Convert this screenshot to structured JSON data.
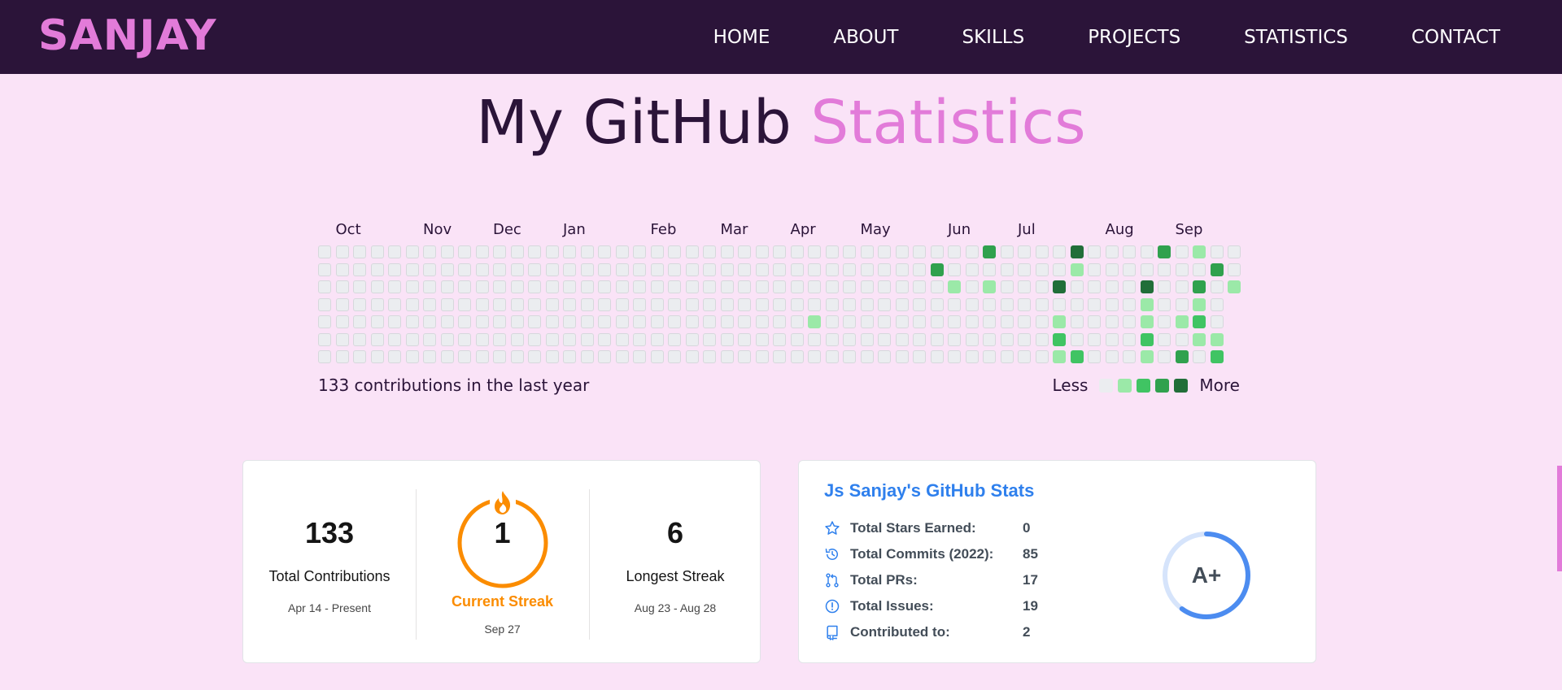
{
  "nav": {
    "logo": "SANJAY",
    "links": [
      "HOME",
      "ABOUT",
      "SKILLS",
      "PROJECTS",
      "STATISTICS",
      "CONTACT"
    ]
  },
  "heading": {
    "prefix": "My GitHub",
    "accent": "Statistics"
  },
  "calendar": {
    "months": [
      "Oct",
      "Nov",
      "Dec",
      "Jan",
      "Feb",
      "Mar",
      "Apr",
      "May",
      "Jun",
      "Jul",
      "Aug",
      "Sep"
    ],
    "month_week_index": [
      1,
      6,
      10,
      14,
      19,
      23,
      27,
      31,
      36,
      40,
      45,
      49
    ],
    "weeks": 53,
    "last_week_days": 3,
    "active_cells": [
      {
        "week": 38,
        "day": 0,
        "level": 3
      },
      {
        "week": 43,
        "day": 0,
        "level": 4
      },
      {
        "week": 48,
        "day": 0,
        "level": 3
      },
      {
        "week": 50,
        "day": 0,
        "level": 1
      },
      {
        "week": 35,
        "day": 1,
        "level": 3
      },
      {
        "week": 43,
        "day": 1,
        "level": 1
      },
      {
        "week": 51,
        "day": 1,
        "level": 3
      },
      {
        "week": 36,
        "day": 2,
        "level": 1
      },
      {
        "week": 38,
        "day": 2,
        "level": 1
      },
      {
        "week": 42,
        "day": 2,
        "level": 4
      },
      {
        "week": 47,
        "day": 2,
        "level": 4
      },
      {
        "week": 50,
        "day": 2,
        "level": 3
      },
      {
        "week": 52,
        "day": 2,
        "level": 1
      },
      {
        "week": 47,
        "day": 3,
        "level": 1
      },
      {
        "week": 50,
        "day": 3,
        "level": 1
      },
      {
        "week": 28,
        "day": 4,
        "level": 1
      },
      {
        "week": 42,
        "day": 4,
        "level": 1
      },
      {
        "week": 47,
        "day": 4,
        "level": 1
      },
      {
        "week": 49,
        "day": 4,
        "level": 1
      },
      {
        "week": 50,
        "day": 4,
        "level": 2
      },
      {
        "week": 42,
        "day": 5,
        "level": 2
      },
      {
        "week": 47,
        "day": 5,
        "level": 2
      },
      {
        "week": 50,
        "day": 5,
        "level": 1
      },
      {
        "week": 51,
        "day": 5,
        "level": 1
      },
      {
        "week": 42,
        "day": 6,
        "level": 1
      },
      {
        "week": 43,
        "day": 6,
        "level": 2
      },
      {
        "week": 47,
        "day": 6,
        "level": 1
      },
      {
        "week": 49,
        "day": 6,
        "level": 3
      },
      {
        "week": 51,
        "day": 6,
        "level": 2
      }
    ],
    "level_colors": [
      "#ebedf0",
      "#9be9a8",
      "#40c463",
      "#30a14e",
      "#216e39"
    ],
    "summary": "133 contributions in the last year",
    "legend_less": "Less",
    "legend_more": "More"
  },
  "streak": {
    "total": {
      "value": "133",
      "label": "Total Contributions",
      "range": "Apr 14 - Present"
    },
    "current": {
      "value": "1",
      "label": "Current Streak",
      "range": "Sep 27"
    },
    "longest": {
      "value": "6",
      "label": "Longest Streak",
      "range": "Aug 23 - Aug 28"
    },
    "accent_color": "#fb8c00"
  },
  "stats": {
    "title": "Js Sanjay's GitHub Stats",
    "rows": [
      {
        "icon": "star-icon",
        "label": "Total Stars Earned:",
        "value": "0"
      },
      {
        "icon": "history-icon",
        "label": "Total Commits (2022):",
        "value": "85"
      },
      {
        "icon": "pull-request-icon",
        "label": "Total PRs:",
        "value": "17"
      },
      {
        "icon": "issue-icon",
        "label": "Total Issues:",
        "value": "19"
      },
      {
        "icon": "repo-icon",
        "label": "Contributed to:",
        "value": "2"
      }
    ],
    "grade": "A+",
    "grade_progress": 0.6,
    "title_color": "#2f80ed",
    "ring_color": "#4c8cf0"
  }
}
